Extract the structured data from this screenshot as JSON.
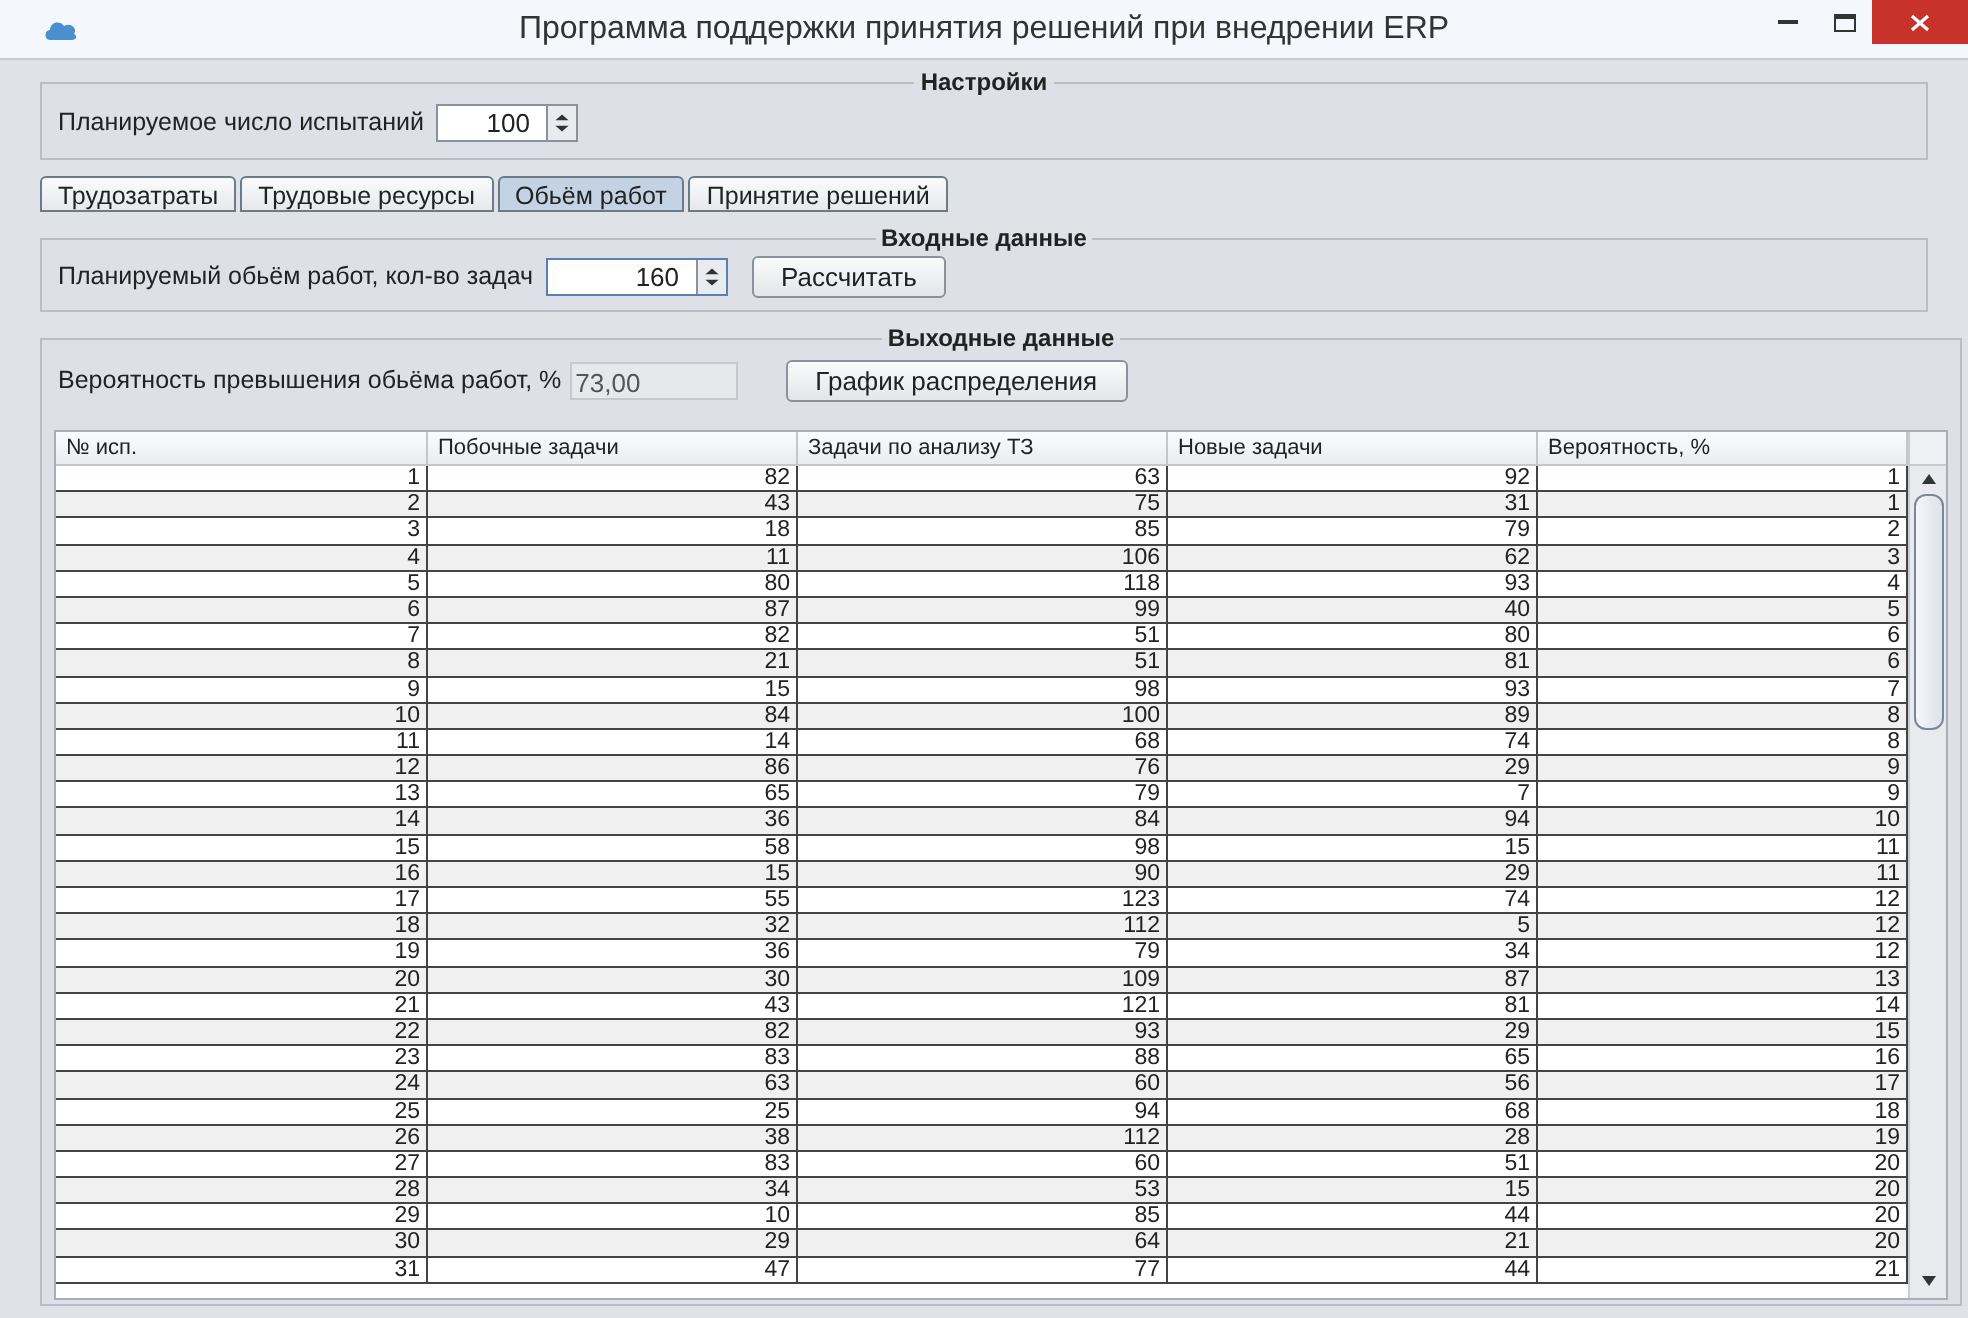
{
  "window": {
    "title": "Программа поддержки принятия решений при внедрении ERP"
  },
  "settings": {
    "legend": "Настройки",
    "trials_label": "Планируемое число испытаний",
    "trials_value": "100"
  },
  "tabs": [
    {
      "label": "Трудозатраты",
      "selected": false
    },
    {
      "label": "Трудовые ресурсы",
      "selected": false
    },
    {
      "label": "Обьём работ",
      "selected": true
    },
    {
      "label": "Принятие решений",
      "selected": false
    }
  ],
  "input": {
    "legend": "Входные данные",
    "volume_label": "Планируемый обьём работ, кол-во задач",
    "volume_value": "160",
    "calculate_button": "Рассчитать"
  },
  "output": {
    "legend": "Выходные данные",
    "probability_label": "Вероятность превышения обьёма работ, %",
    "probability_value": "73,00",
    "chart_button": "График распределения"
  },
  "table": {
    "columns": [
      "№ исп.",
      "Побочные задачи",
      "Задачи по анализу ТЗ",
      "Новые задачи",
      "Вероятность, %"
    ],
    "rows": [
      [
        "1",
        "82",
        "63",
        "92",
        "1"
      ],
      [
        "2",
        "43",
        "75",
        "31",
        "1"
      ],
      [
        "3",
        "18",
        "85",
        "79",
        "2"
      ],
      [
        "4",
        "11",
        "106",
        "62",
        "3"
      ],
      [
        "5",
        "80",
        "118",
        "93",
        "4"
      ],
      [
        "6",
        "87",
        "99",
        "40",
        "5"
      ],
      [
        "7",
        "82",
        "51",
        "80",
        "6"
      ],
      [
        "8",
        "21",
        "51",
        "81",
        "6"
      ],
      [
        "9",
        "15",
        "98",
        "93",
        "7"
      ],
      [
        "10",
        "84",
        "100",
        "89",
        "8"
      ],
      [
        "11",
        "14",
        "68",
        "74",
        "8"
      ],
      [
        "12",
        "86",
        "76",
        "29",
        "9"
      ],
      [
        "13",
        "65",
        "79",
        "7",
        "9"
      ],
      [
        "14",
        "36",
        "84",
        "94",
        "10"
      ],
      [
        "15",
        "58",
        "98",
        "15",
        "11"
      ],
      [
        "16",
        "15",
        "90",
        "29",
        "11"
      ],
      [
        "17",
        "55",
        "123",
        "74",
        "12"
      ],
      [
        "18",
        "32",
        "112",
        "5",
        "12"
      ],
      [
        "19",
        "36",
        "79",
        "34",
        "12"
      ],
      [
        "20",
        "30",
        "109",
        "87",
        "13"
      ],
      [
        "21",
        "43",
        "121",
        "81",
        "14"
      ],
      [
        "22",
        "82",
        "93",
        "29",
        "15"
      ],
      [
        "23",
        "83",
        "88",
        "65",
        "16"
      ],
      [
        "24",
        "63",
        "60",
        "56",
        "17"
      ],
      [
        "25",
        "25",
        "94",
        "68",
        "18"
      ],
      [
        "26",
        "38",
        "112",
        "28",
        "19"
      ],
      [
        "27",
        "83",
        "60",
        "51",
        "20"
      ],
      [
        "28",
        "34",
        "53",
        "15",
        "20"
      ],
      [
        "29",
        "10",
        "85",
        "44",
        "20"
      ],
      [
        "30",
        "29",
        "64",
        "21",
        "20"
      ],
      [
        "31",
        "47",
        "77",
        "44",
        "21"
      ]
    ]
  }
}
